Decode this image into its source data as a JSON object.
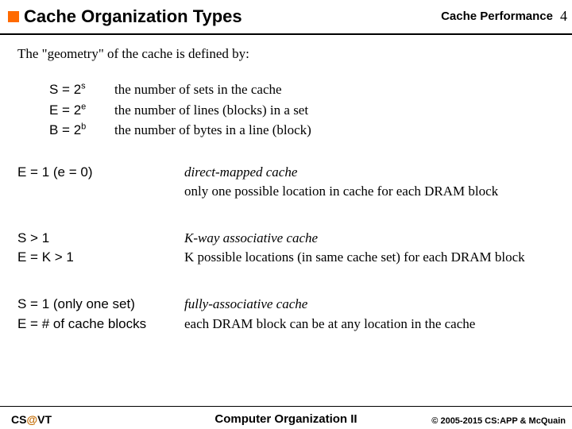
{
  "header": {
    "title": "Cache Organization Types",
    "tag": "Cache Performance",
    "page": "4"
  },
  "intro": "The \"geometry\" of the cache is defined by:",
  "geom": [
    {
      "sym_base": "S = 2",
      "sym_sup": "s",
      "desc": "the number of sets in the cache"
    },
    {
      "sym_base": "E = 2",
      "sym_sup": "e",
      "desc": "the number of lines (blocks) in a set"
    },
    {
      "sym_base": "B = 2",
      "sym_sup": "b",
      "desc": "the number of bytes in a line (block)"
    }
  ],
  "types": [
    {
      "cond1": "E = 1 (e = 0)",
      "cond2": "",
      "name": "direct-mapped cache",
      "desc": "only one possible location in cache for each DRAM block"
    },
    {
      "cond1": "S > 1",
      "cond2": "E = K > 1",
      "name": "K-way associative cache",
      "desc": "K possible locations (in same cache set) for each DRAM block"
    },
    {
      "cond1": "S = 1 (only one set)",
      "cond2": "E = # of cache blocks",
      "name": "fully-associative cache",
      "desc": "each DRAM block can be at any location in the cache"
    }
  ],
  "footer": {
    "left_pre": "CS",
    "left_at": "@",
    "left_post": "VT",
    "center": "Computer Organization II",
    "right": "© 2005-2015 CS:APP & McQuain"
  }
}
